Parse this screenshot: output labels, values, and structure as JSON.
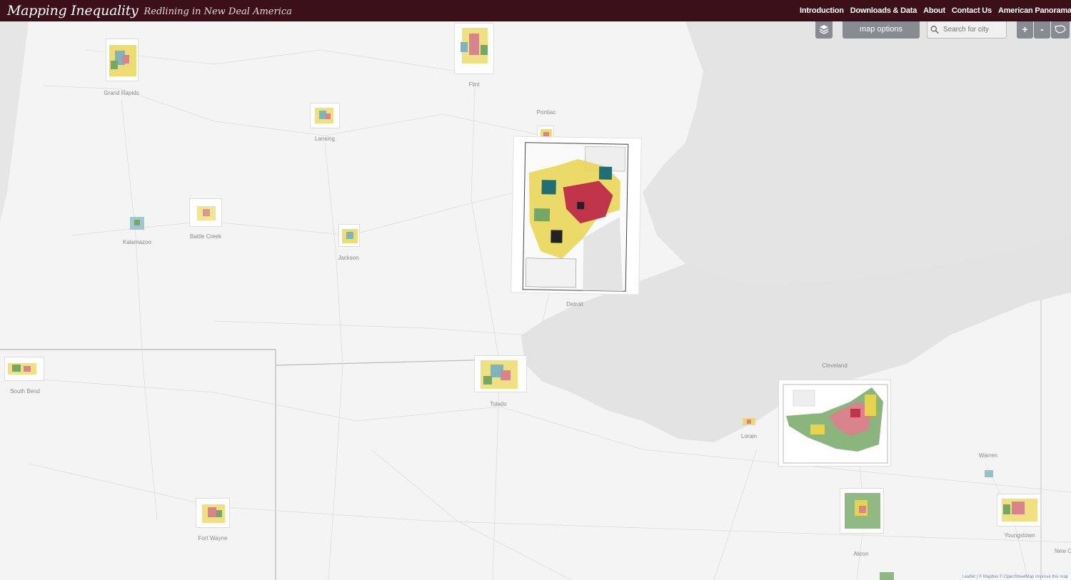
{
  "header": {
    "title": "Mapping Inequality",
    "subtitle": "Redlining in New Deal America",
    "nav": [
      "Introduction",
      "Downloads & Data",
      "About",
      "Contact Us",
      "American Panorama"
    ]
  },
  "controls": {
    "layers_icon": "layers-icon",
    "map_options_label": "map options",
    "search_placeholder": "Search for city",
    "zoom_in": "+",
    "zoom_out": "-",
    "usa_icon": "us-map-icon"
  },
  "cities": [
    {
      "id": "grand-rapids",
      "label": "Grand Rapids"
    },
    {
      "id": "flint",
      "label": "Flint"
    },
    {
      "id": "pontiac",
      "label": "Pontiac"
    },
    {
      "id": "lansing",
      "label": "Lansing"
    },
    {
      "id": "kalamazoo",
      "label": "Kalamazoo"
    },
    {
      "id": "battle-creek",
      "label": "Battle Creek"
    },
    {
      "id": "jackson",
      "label": "Jackson"
    },
    {
      "id": "detroit",
      "label": "Detroit"
    },
    {
      "id": "south-bend",
      "label": "South Bend"
    },
    {
      "id": "toledo",
      "label": "Toledo"
    },
    {
      "id": "cleveland",
      "label": "Cleveland"
    },
    {
      "id": "lorain",
      "label": "Lorain"
    },
    {
      "id": "warren",
      "label": "Warren"
    },
    {
      "id": "fort-wayne",
      "label": "Fort Wayne"
    },
    {
      "id": "akron",
      "label": "Akron"
    },
    {
      "id": "youngstown",
      "label": "Youngstown"
    },
    {
      "id": "new-castle",
      "label": "New C"
    }
  ],
  "attribution": "Leaflet | © Mapbox © OpenStreetMap Improve this map",
  "colors": {
    "header_bg": "#3b1018",
    "grade_a": "#76a865",
    "grade_b": "#7cb5bd",
    "grade_c": "#e8d34d",
    "grade_d": "#d9838d",
    "water": "#e3e3e3",
    "land": "#f4f4f4"
  }
}
